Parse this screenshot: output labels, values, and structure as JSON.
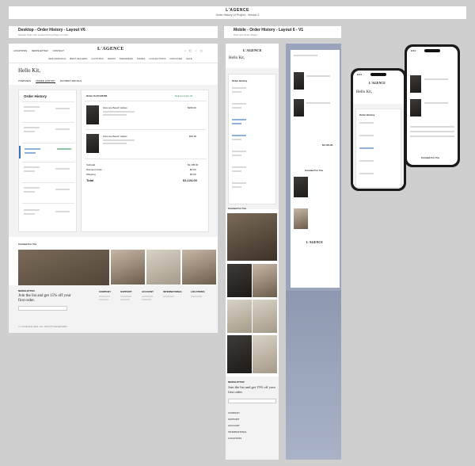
{
  "header": {
    "brand": "L'AGENCE",
    "subtitle": "Order History UI Project - Version 2"
  },
  "desktop": {
    "title": "Desktop - Order History - Layout V6",
    "subtitle": "Sidebar Style with Inward Facing Page on Click",
    "topnav_left": [
      "LOCATIONS",
      "NEWSLETTER",
      "CONTACT"
    ],
    "brand": "L'AGENCE",
    "nav": [
      "NEW ARRIVALS",
      "BEST SELLERS",
      "CLOTHING",
      "DENIM",
      "SWIMWEAR",
      "SHOES",
      "COLLECTIONS",
      "DISCOVER",
      "SALE"
    ],
    "greeting": "Hello Kit,",
    "tabs": [
      "OVERVIEW",
      "ORDER HISTORY",
      "PAYMENT DETAILS"
    ],
    "orders_heading": "Order History",
    "order_detail_title": "Order #L4V123456",
    "order_status": "Delivered Apr 24",
    "items": [
      {
        "name": "Florence Beach Jacket",
        "price": "$295.00"
      },
      {
        "name": "Florence Beach Jacket",
        "price": "$95.00"
      }
    ],
    "totals": [
      {
        "label": "Subtotal",
        "value": "$1,185.00"
      },
      {
        "label": "Discount Code",
        "value": "$0.00"
      },
      {
        "label": "Shipping",
        "value": "$0.00"
      },
      {
        "label": "Total",
        "value": "$1,124.00"
      }
    ],
    "curated_heading": "Curated For You",
    "newsletter_label": "NEWSLETTER",
    "newsletter_text": "Join the list and get 15% off your first order.",
    "footer_cols": [
      "COMPANY",
      "SUPPORT",
      "ACCOUNT",
      "INTERNATIONAL",
      "LOCATIONS"
    ],
    "copyright": "© L'AGENCE 2024. ALL RIGHTS RESERVED"
  },
  "mobile": {
    "title": "Mobile - Order History - Layout 6 - V1",
    "subtitle": "Web and Order Shape",
    "brand": "L'AGENCE",
    "greeting": "Hello Kit,",
    "orders_heading": "Order History",
    "curated_heading": "Curated For You",
    "newsletter_label": "NEWSLETTER",
    "newsletter_text": "Join the list and get 15% off your first order.",
    "accordions": [
      "COMPANY",
      "SUPPORT",
      "ACCOUNT",
      "INTERNATIONAL",
      "LOCATIONS"
    ],
    "detail_total": "$1,124.00",
    "detail_brand": "L'AGENCE"
  },
  "phones": {
    "time": "9:41",
    "brand": "L'AGENCE",
    "greeting": "Hello Kit,",
    "orders_heading": "Order History",
    "curated": "Curated For You"
  }
}
